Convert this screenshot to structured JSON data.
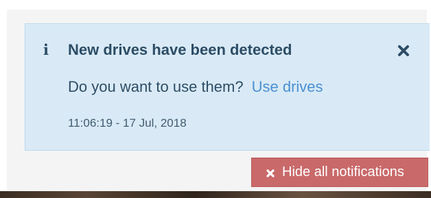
{
  "notification": {
    "title": "New drives have been detected",
    "message": "Do you want to use them?",
    "action_label": "Use drives",
    "timestamp": "11:06:19 - 17 Jul, 2018",
    "icon": "info-icon",
    "close_icon": "close-icon",
    "colors": {
      "background": "#d9eaf6",
      "text": "#2d4d66",
      "link": "#4a90d2"
    }
  },
  "actions": {
    "hide_all_label": "Hide all notifications",
    "hide_all_icon": "close-icon",
    "hide_all_color": "#c9696a"
  }
}
